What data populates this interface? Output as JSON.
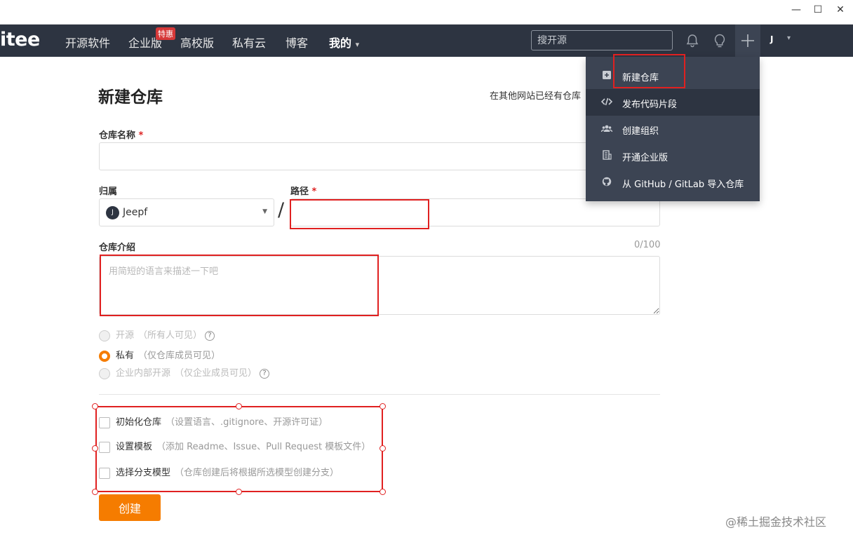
{
  "window": {
    "minimize": "—",
    "maximize": "☐",
    "close": "✕"
  },
  "nav": {
    "logo": "itee",
    "items": [
      "开源软件",
      "企业版",
      "高校版",
      "私有云",
      "博客",
      "我的"
    ],
    "badge": "特惠",
    "my_caret": "▾",
    "search_placeholder": "搜开源",
    "user_initial": "J",
    "user_caret": "▾"
  },
  "dropdown": {
    "items": [
      {
        "label": "新建仓库",
        "icon": "plus-square-icon"
      },
      {
        "label": "发布代码片段",
        "icon": "code-icon"
      },
      {
        "label": "创建组织",
        "icon": "users-icon"
      },
      {
        "label": "开通企业版",
        "icon": "building-icon"
      },
      {
        "label": "从 GitHub / GitLab 导入仓库",
        "icon": "github-icon"
      }
    ]
  },
  "form": {
    "title": "新建仓库",
    "import_hint": "在其他网站已经有仓库",
    "repo_name_label": "仓库名称",
    "required_mark": "*",
    "owner_label": "归属",
    "owner_initial": "J",
    "owner_name": "Jeepf",
    "path_label": "路径",
    "slash": "/",
    "desc_label": "仓库介绍",
    "desc_counter": "0/100",
    "desc_placeholder": "用简短的语言来描述一下吧",
    "visibility": [
      {
        "label": "开源",
        "note": "（所有人可见）",
        "help": "?",
        "state": "disabled"
      },
      {
        "label": "私有",
        "note": "（仅仓库成员可见）",
        "state": "selected"
      },
      {
        "label": "企业内部开源",
        "note": "（仅企业成员可见）",
        "help": "?",
        "state": "disabled"
      }
    ],
    "options": [
      {
        "label": "初始化仓库",
        "note": "（设置语言、.gitignore、开源许可证）"
      },
      {
        "label": "设置模板",
        "note": "（添加 Readme、Issue、Pull Request 模板文件）"
      },
      {
        "label": "选择分支模型",
        "note": "（仓库创建后将根据所选模型创建分支）"
      }
    ],
    "submit_label": "创建"
  },
  "watermark": "@稀土掘金技术社区",
  "colors": {
    "nav_bg": "#2d3441",
    "accent": "#f57c00",
    "annotation": "#e02020"
  }
}
